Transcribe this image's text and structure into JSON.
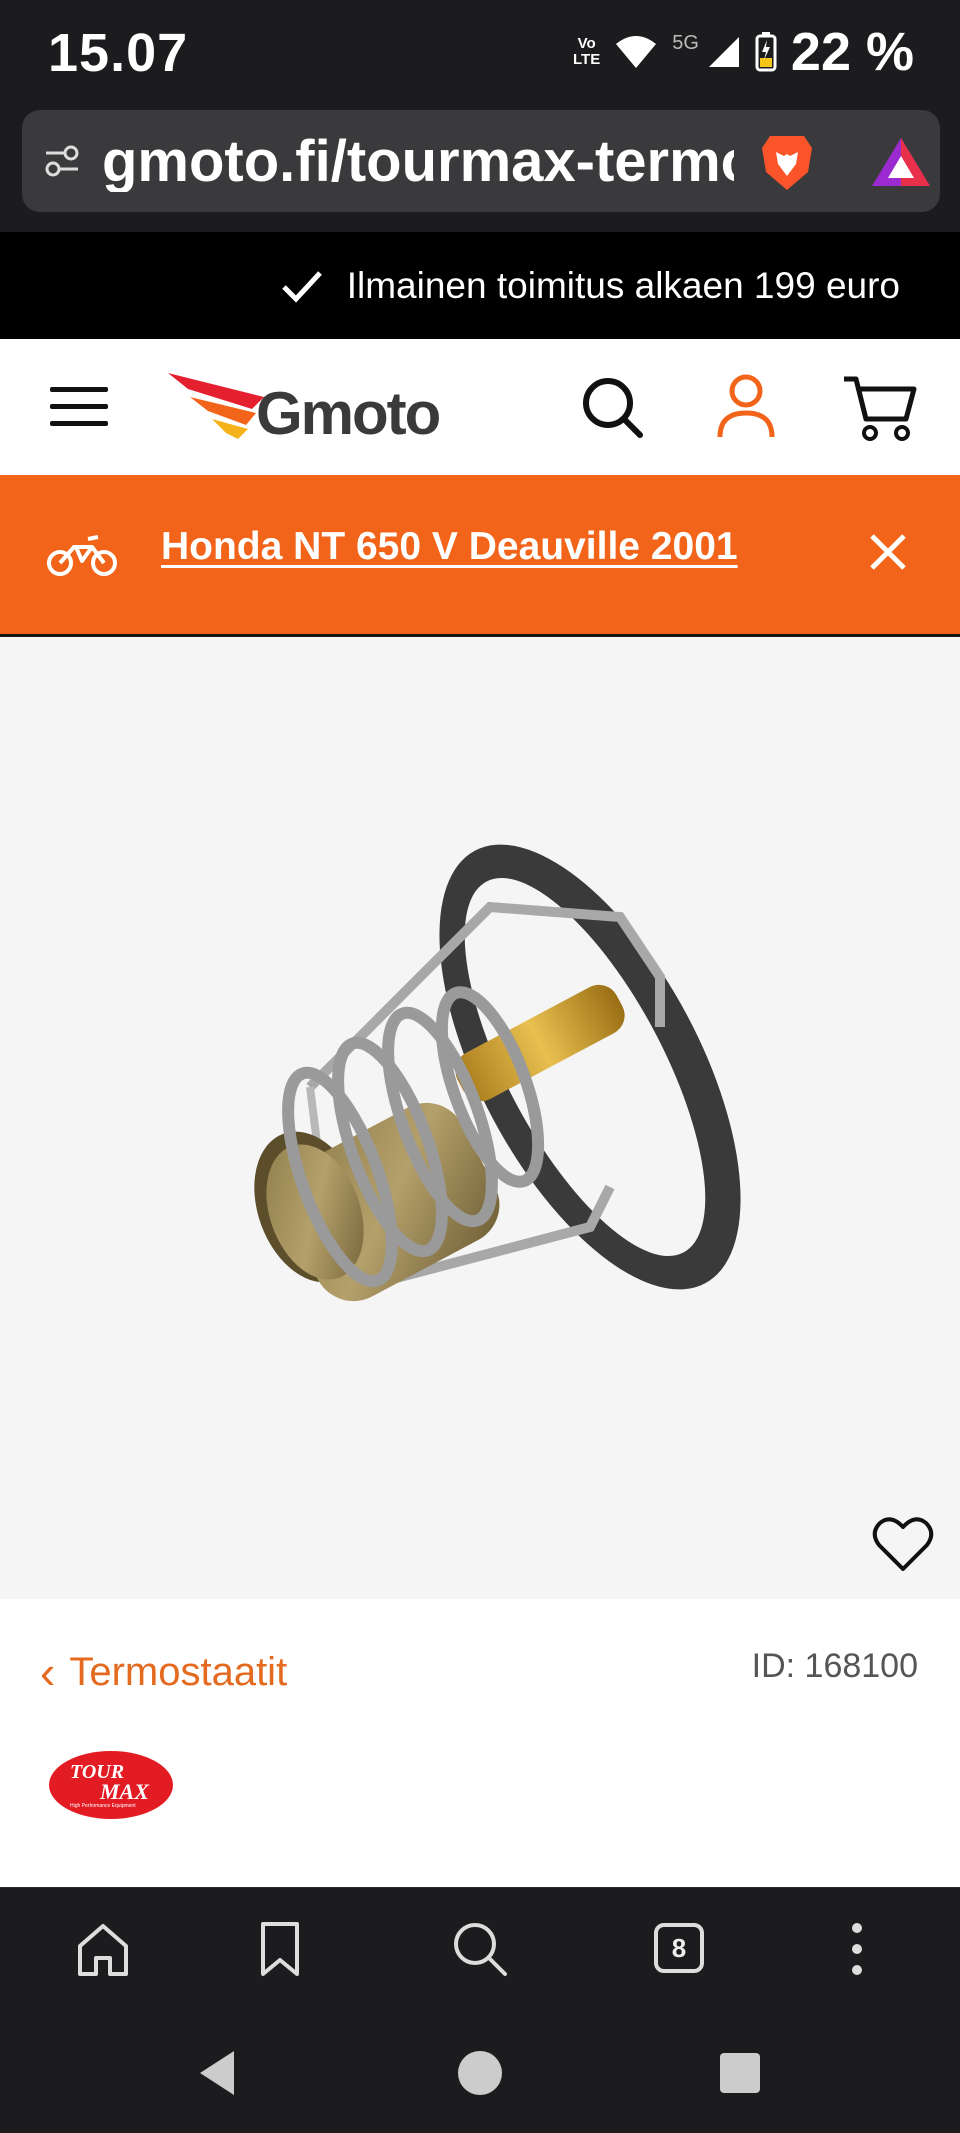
{
  "status_bar": {
    "time": "15.07",
    "volte_top": "Vo",
    "volte_bottom": "LTE",
    "network": "5G",
    "battery": "22 %"
  },
  "browser": {
    "url": "gmoto.fi/tourmax-termostaatti",
    "tab_count": "8"
  },
  "promo": {
    "text": "Ilmainen toimitus alkaen 199 euro"
  },
  "header": {
    "logo_text": "Gmoto"
  },
  "vehicle": {
    "name": "Honda NT 650 V Deauville 2001"
  },
  "product": {
    "breadcrumb_arrow": "‹",
    "breadcrumb": "Termostaatit",
    "id_label": "ID: 168100",
    "brand_top": "TOUR",
    "brand_bottom": "MAX",
    "brand_tagline": "High Performance Equipment"
  },
  "colors": {
    "accent": "#f26419",
    "link": "#e36a1f",
    "promo_bg": "#000000",
    "chrome_bg": "#1c1c1e"
  },
  "icons": {
    "url_bar": [
      "tune-icon",
      "brave-lion-icon",
      "brave-rewards-icon"
    ],
    "header": [
      "menu-icon",
      "search-icon",
      "account-icon",
      "cart-icon"
    ],
    "toolbar": [
      "home-icon",
      "bookmark-icon",
      "search-icon",
      "tabs-icon",
      "more-icon"
    ],
    "navbar": [
      "back-icon",
      "home-icon",
      "recents-icon"
    ]
  }
}
